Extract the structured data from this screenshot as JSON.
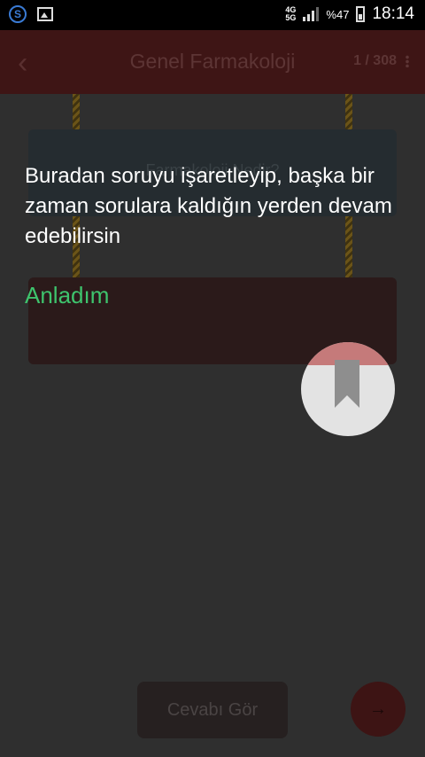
{
  "status_bar": {
    "network_top": "4G",
    "network_sub": "5G",
    "battery": "%47",
    "time": "18:14"
  },
  "appbar": {
    "title": "Genel Farmakoloji",
    "counter": "1 / 308"
  },
  "question_card": {
    "faint_text": "Farmakoloji Nedir?"
  },
  "tutorial": {
    "message": "Buradan soruyu işaretleyip, başka bir zaman sorulara kaldığın yerden devam edebilirsin",
    "dismiss_label": "Anladım"
  },
  "bottom": {
    "show_answer_label": "Cevabı Gör",
    "next_icon": "→"
  },
  "icons": {
    "back": "‹"
  },
  "colors": {
    "accent_green": "#3ec46d",
    "appbar_dark": "#3e1515",
    "highlight_circle": "#e3e3e3"
  }
}
